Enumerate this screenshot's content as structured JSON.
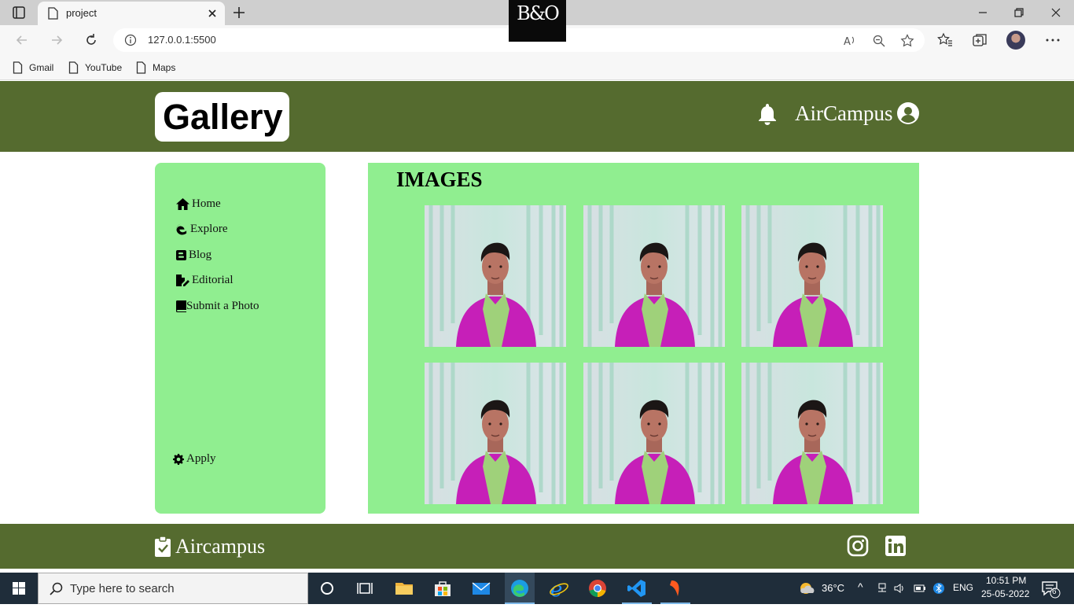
{
  "browser": {
    "tab_title": "project",
    "url": "127.0.0.1:5500",
    "bookmarks": [
      "Gmail",
      "YouTube",
      "Maps"
    ],
    "overlay_logo": "B&O"
  },
  "header": {
    "logo": "Gallery",
    "brand": "AirCampus"
  },
  "sidebar": {
    "items": [
      {
        "label": "Home",
        "icon": "home-icon"
      },
      {
        "label": "Explore",
        "icon": "edge-logo-icon"
      },
      {
        "label": "Blog",
        "icon": "blogger-icon"
      },
      {
        "label": "Editorial",
        "icon": "file-edit-icon"
      },
      {
        "label": "Submit a Photo",
        "icon": "book-icon"
      }
    ],
    "apply_label": "Apply"
  },
  "main": {
    "title": "IMAGES",
    "photo_count": 6
  },
  "footer": {
    "brand": "Aircampus"
  },
  "taskbar": {
    "search_placeholder": "Type here to search",
    "weather": "36°C",
    "language": "ENG",
    "time": "10:51 PM",
    "date": "25-05-2022",
    "notifications": "6"
  },
  "colors": {
    "header_bg": "#556b2f",
    "panel_bg": "#90ee90"
  }
}
